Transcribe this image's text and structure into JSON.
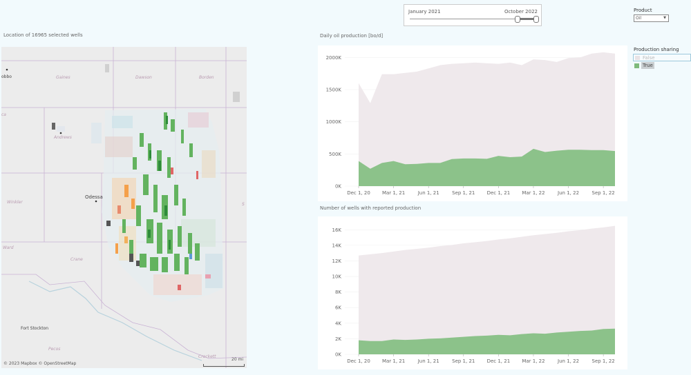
{
  "filters": {
    "date_start": "January 2021",
    "date_end": "October 2022",
    "product_label": "Product",
    "product_value": "Oil",
    "sharing_label": "Production sharing",
    "sharing_false": "False",
    "sharing_true": "True"
  },
  "map": {
    "title": "Location of 16965 selected wells",
    "labels": {
      "gaines": "Gaines",
      "dawson": "Dawson",
      "borden": "Borden",
      "andrews": "Andrews",
      "odessa": "Odessa",
      "winkler": "Winkler",
      "ward": "Ward",
      "crane": "Crane",
      "fort_stockton": "Fort Stockton",
      "pecos": "Pecos",
      "crockett": "Crockett",
      "bbo": "obbo",
      "ca": "ca",
      "s": "S"
    },
    "scale": "20 mi",
    "attribution": "© 2023 Mapbox  © OpenStreetMap"
  },
  "colors": {
    "shared": "#8cc28a",
    "not_shared": "#efe9ec"
  },
  "chart_data": [
    {
      "type": "area",
      "title": "Daily oil production [bo/d]",
      "xticks": [
        "Dec 1, 20",
        "Mar 1, 21",
        "Jun 1, 21",
        "Sep 1, 21",
        "Dec 1, 21",
        "Mar 1, 22",
        "Jun 1, 22",
        "Sep 1, 22"
      ],
      "yticks": [
        "0K",
        "500K",
        "1000K",
        "1500K",
        "2000K"
      ],
      "ylim": [
        0,
        2100000
      ],
      "x": [
        "2020-12",
        "2021-01",
        "2021-02",
        "2021-03",
        "2021-04",
        "2021-05",
        "2021-06",
        "2021-07",
        "2021-08",
        "2021-09",
        "2021-10",
        "2021-11",
        "2021-12",
        "2022-01",
        "2022-02",
        "2022-03",
        "2022-04",
        "2022-05",
        "2022-06",
        "2022-07",
        "2022-08",
        "2022-09",
        "2022-10"
      ],
      "series": [
        {
          "name": "True",
          "values": [
            390000,
            270000,
            360000,
            390000,
            340000,
            345000,
            360000,
            360000,
            420000,
            430000,
            430000,
            425000,
            470000,
            450000,
            460000,
            580000,
            530000,
            550000,
            565000,
            565000,
            560000,
            560000,
            545000
          ]
        },
        {
          "name": "False",
          "values": [
            1600000,
            1290000,
            1740000,
            1740000,
            1760000,
            1780000,
            1830000,
            1880000,
            1900000,
            1910000,
            1920000,
            1910000,
            1900000,
            1920000,
            1880000,
            1970000,
            1960000,
            1930000,
            1990000,
            2000000,
            2060000,
            2080000,
            2060000
          ]
        }
      ]
    },
    {
      "type": "area",
      "title": "Number of wells with reported production",
      "xticks": [
        "Dec 1, 20",
        "Mar 1, 21",
        "Jun 1, 21",
        "Sep 1, 21",
        "Dec 1, 21",
        "Mar 1, 22",
        "Jun 1, 22",
        "Sep 1, 22"
      ],
      "yticks": [
        "0K",
        "2K",
        "4K",
        "6K",
        "8K",
        "10K",
        "12K",
        "14K",
        "16K"
      ],
      "ylim": [
        0,
        17000
      ],
      "x": [
        "2020-12",
        "2021-01",
        "2021-02",
        "2021-03",
        "2021-04",
        "2021-05",
        "2021-06",
        "2021-07",
        "2021-08",
        "2021-09",
        "2021-10",
        "2021-11",
        "2021-12",
        "2022-01",
        "2022-02",
        "2022-03",
        "2022-04",
        "2022-05",
        "2022-06",
        "2022-07",
        "2022-08",
        "2022-09",
        "2022-10"
      ],
      "series": [
        {
          "name": "True",
          "values": [
            1800,
            1700,
            1700,
            1900,
            1850,
            1900,
            2000,
            2050,
            2150,
            2250,
            2350,
            2400,
            2500,
            2450,
            2600,
            2700,
            2650,
            2800,
            2900,
            3000,
            3050,
            3250,
            3300
          ]
        },
        {
          "name": "False",
          "values": [
            12700,
            12850,
            13000,
            13200,
            13400,
            13550,
            13700,
            13900,
            14050,
            14250,
            14400,
            14550,
            14750,
            14900,
            15100,
            15300,
            15450,
            15600,
            15800,
            15950,
            16150,
            16300,
            16500
          ]
        }
      ]
    }
  ]
}
